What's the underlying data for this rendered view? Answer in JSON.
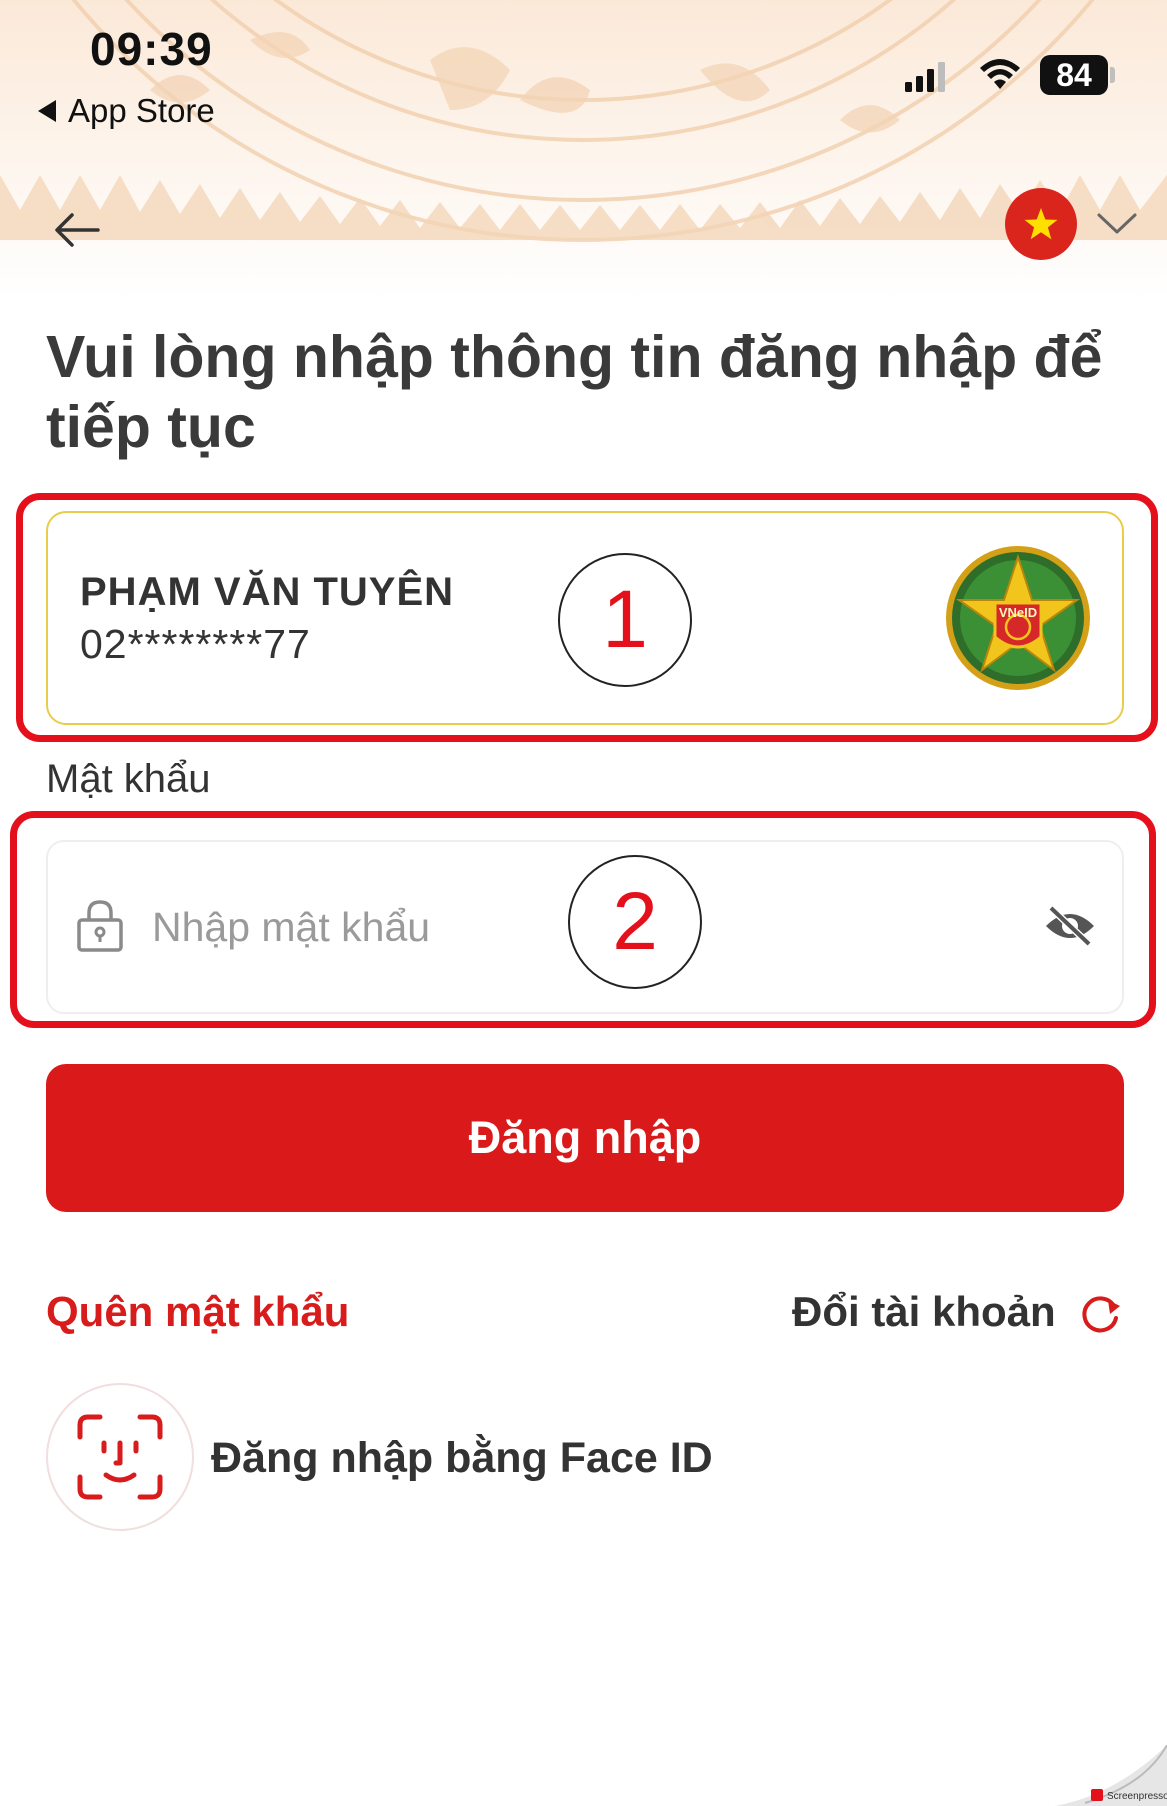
{
  "status_bar": {
    "time": "09:39",
    "back_app": "App Store",
    "battery": "84"
  },
  "header": {
    "back_icon": "arrow-left-icon",
    "language_flag_icon": "vietnam-flag-icon",
    "language_chevron_icon": "chevron-down-icon"
  },
  "title": "Vui lòng nhập thông tin đăng nhập để tiếp tục",
  "account": {
    "name": "PHẠM VĂN TUYÊN",
    "id_masked": "02********77",
    "emblem_icon": "vneid-police-emblem-icon",
    "emblem_text": "VNeID"
  },
  "annotations": {
    "marker_1": "1",
    "marker_2": "2"
  },
  "password": {
    "label": "Mật khẩu",
    "placeholder": "Nhập mật khẩu",
    "value": ""
  },
  "login_button": "Đăng nhập",
  "links": {
    "forgot_password": "Quên mật khẩu",
    "switch_account": "Đổi tài khoản"
  },
  "face_id": {
    "label": "Đăng nhập bằng Face ID"
  },
  "colors": {
    "primary_red": "#da1a1a",
    "annotation_red": "#e4101b",
    "card_border_gold": "#e8cc4a",
    "text_dark": "#333333"
  },
  "watermark_text": "Screenpresso"
}
